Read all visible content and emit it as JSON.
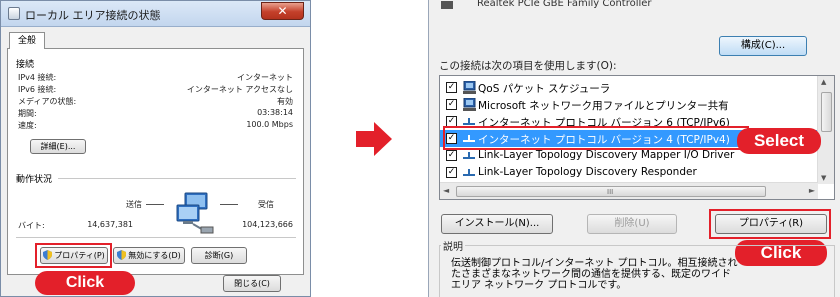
{
  "left_window": {
    "title": "ローカル エリア接続の状態",
    "close_glyph": "✕",
    "tab": "全般",
    "connection_section": "接続",
    "rows": [
      {
        "label": "IPv4 接続:",
        "value": "インターネット"
      },
      {
        "label": "IPv6 接続:",
        "value": "インターネット アクセスなし"
      },
      {
        "label": "メディアの状態:",
        "value": "有効"
      },
      {
        "label": "期間:",
        "value": "03:38:14"
      },
      {
        "label": "速度:",
        "value": "100.0 Mbps"
      }
    ],
    "details_button": "詳細(E)...",
    "activity_section": "動作状況",
    "sent_label": "送信",
    "received_label": "受信",
    "bytes_label": "バイト:",
    "bytes_sent": "14,637,381",
    "bytes_received": "104,123,666",
    "properties_button": "プロパティ(P)",
    "disable_button": "無効にする(D)",
    "diagnose_button": "診断(G)",
    "close_button": "閉じる(C)",
    "callout": "Click"
  },
  "right_window": {
    "adapter_name": "Realtek PCIe GBE Family Controller",
    "configure_button": "構成(C)...",
    "items_label": "この接続は次の項目を使用します(O):",
    "items": [
      {
        "text": "QoS パケット スケジューラ",
        "checked": true,
        "icon": "qos-icon"
      },
      {
        "text": "Microsoft ネットワーク用ファイルとプリンター共有",
        "checked": true,
        "icon": "file-share-icon"
      },
      {
        "text": "インターネット プロトコル バージョン 6 (TCP/IPv6)",
        "checked": true,
        "icon": "protocol-icon"
      },
      {
        "text": "インターネット プロトコル バージョン 4 (TCP/IPv4)",
        "checked": true,
        "icon": "protocol-icon",
        "selected": true
      },
      {
        "text": "Link-Layer Topology Discovery Mapper I/O Driver",
        "checked": true,
        "icon": "protocol-icon"
      },
      {
        "text": "Link-Layer Topology Discovery Responder",
        "checked": true,
        "icon": "protocol-icon"
      }
    ],
    "check_glyph": "✓",
    "scroll_up": "▲",
    "scroll_down": "▼",
    "scroll_left": "◄",
    "scroll_right": "►",
    "scroll_grip": "III",
    "install_button": "インストール(N)...",
    "uninstall_button": "削除(U)",
    "properties_button": "プロパティ(R)",
    "description_title": "説明",
    "description_text": "伝送制御プロトコル/インターネット プロトコル。相互接続されたさまざまなネットワーク間の通信を提供する、既定のワイド エリア ネットワーク プロトコルです。",
    "select_callout": "Select",
    "click_callout": "Click"
  },
  "colors": {
    "callout_red": "#e3202a",
    "selection_blue": "#3399ff"
  }
}
